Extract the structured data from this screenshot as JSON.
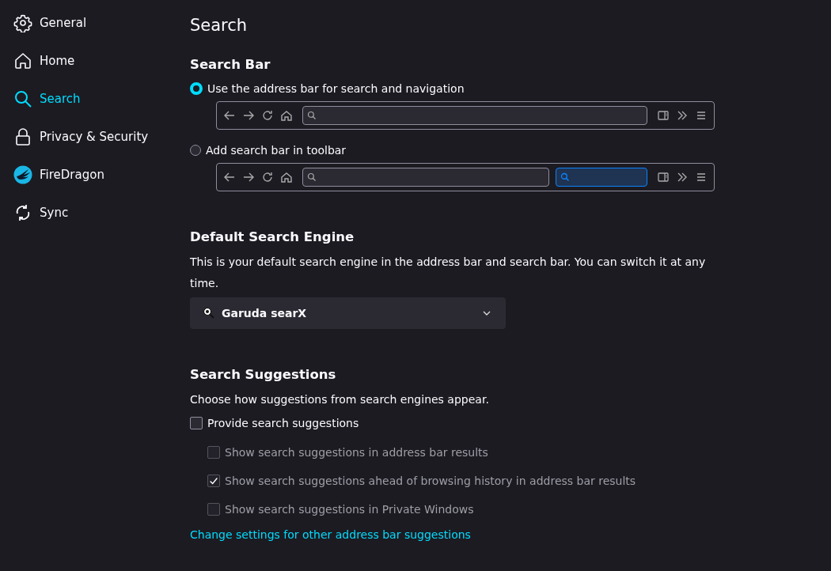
{
  "sidebar": {
    "items": [
      {
        "label": "General",
        "kind": "gear",
        "selected": false
      },
      {
        "label": "Home",
        "kind": "home",
        "selected": false
      },
      {
        "label": "Search",
        "kind": "search",
        "selected": true
      },
      {
        "label": "Privacy & Security",
        "kind": "lock",
        "selected": false
      },
      {
        "label": "FireDragon",
        "kind": "logo",
        "selected": false
      },
      {
        "label": "Sync",
        "kind": "sync",
        "selected": false
      }
    ]
  },
  "page_title": "Search",
  "search_bar": {
    "heading": "Search Bar",
    "options": [
      {
        "label": "Use the address bar for search and navigation",
        "selected": true,
        "kind": "address_only"
      },
      {
        "label": "Add search bar in toolbar",
        "selected": false,
        "kind": "with_search_bar"
      }
    ]
  },
  "default_engine": {
    "heading": "Default Search Engine",
    "description": "This is your default search engine in the address bar and search bar. You can switch it at any time.",
    "value": "Garuda searX"
  },
  "suggestions": {
    "heading": "Search Suggestions",
    "description": "Choose how suggestions from search engines appear.",
    "options": [
      {
        "label": "Provide search suggestions",
        "checked": false,
        "disabled": false,
        "children": [
          {
            "label": "Show search suggestions in address bar results",
            "checked": false,
            "disabled": true
          },
          {
            "label": "Show search suggestions ahead of browsing history in address bar results",
            "checked": true,
            "disabled": true
          },
          {
            "label": "Show search suggestions in Private Windows",
            "checked": false,
            "disabled": true
          }
        ]
      }
    ],
    "link": "Change settings for other address bar suggestions"
  }
}
